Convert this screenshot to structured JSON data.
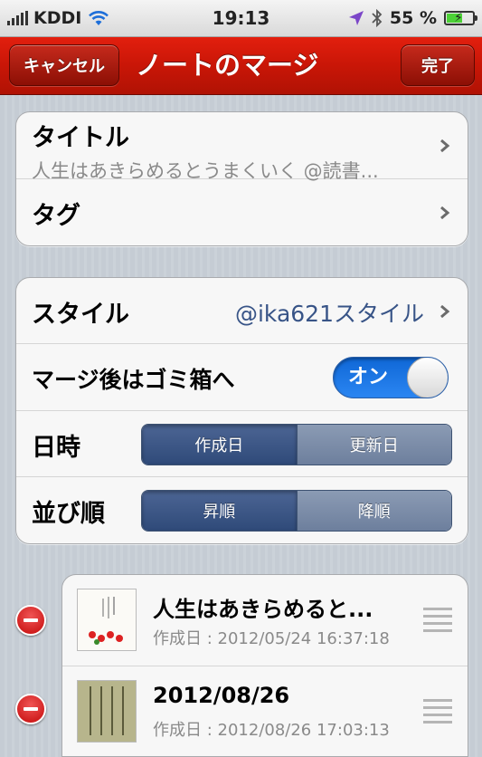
{
  "status_bar": {
    "carrier": "KDDI",
    "time": "19:13",
    "battery_percent": "55 %",
    "battery_level": 0.55
  },
  "nav": {
    "cancel_label": "キャンセル",
    "title": "ノートのマージ",
    "done_label": "完了"
  },
  "details": {
    "title_label": "タイトル",
    "title_value": "人生はあきらめるとうまくいく @読書...",
    "tag_label": "タグ"
  },
  "options": {
    "style_label": "スタイル",
    "style_value": "@ika621スタイル",
    "trash_label": "マージ後はゴミ箱へ",
    "trash_switch": "オン",
    "trash_on": true,
    "date_label": "日時",
    "date_options": [
      "作成日",
      "更新日"
    ],
    "date_selected": "作成日",
    "order_label": "並び順",
    "order_options": [
      "昇順",
      "降順"
    ],
    "order_selected": "昇順"
  },
  "notes": [
    {
      "title": "人生はあきらめると...",
      "date": "作成日 : 2012/05/24 16:37:18"
    },
    {
      "title": "2012/08/26",
      "date": "作成日 : 2012/08/26 17:03:13"
    }
  ],
  "colors": {
    "nav_red": "#c91607",
    "switch_blue": "#1f78e6",
    "segment_selected": "#2f4a79",
    "value_blue": "#385487",
    "delete_red": "#d41313"
  },
  "icons": [
    "signal-icon",
    "wifi-icon",
    "location-icon",
    "bluetooth-icon",
    "battery-icon",
    "chevron-right-icon",
    "delete-icon",
    "reorder-handle-icon"
  ]
}
